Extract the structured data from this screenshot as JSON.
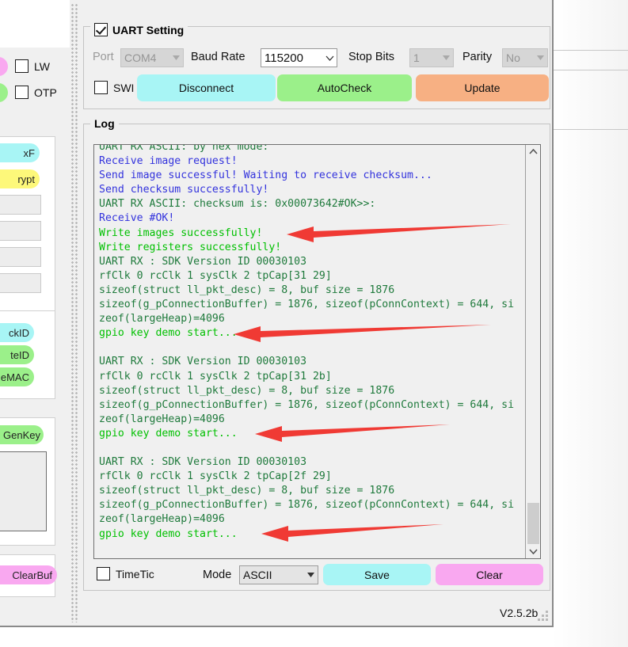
{
  "window": {
    "version_label": "V2.5.2b"
  },
  "sidebar": {
    "checkboxes": [
      {
        "label": "LW",
        "checked": false
      },
      {
        "label": "OTP",
        "checked": false
      }
    ],
    "pills": [
      {
        "label": "xF",
        "color": "#a8f5f5"
      },
      {
        "label": "rypt",
        "color": "#fdf87a"
      },
      {
        "label": "ckID",
        "color": "#a8f5f5"
      },
      {
        "label": "teID",
        "color": "#9bf08a"
      },
      {
        "label": "eMAC",
        "color": "#9bf08a"
      },
      {
        "label": "GenKey",
        "color": "#9bf08a"
      },
      {
        "label": "ClearBuf",
        "color": "#f9a8f0"
      }
    ],
    "edge_pills": [
      {
        "color": "#f9a8f0"
      },
      {
        "color": "#9bf08a"
      }
    ]
  },
  "uart_setting": {
    "title": "UART Setting",
    "enabled": true,
    "port": {
      "label": "Port",
      "value": "COM4",
      "disabled": true
    },
    "baud_rate": {
      "label": "Baud Rate",
      "value": "115200",
      "disabled": false
    },
    "stop_bits": {
      "label": "Stop Bits",
      "value": "1",
      "disabled": true
    },
    "parity": {
      "label": "Parity",
      "value": "No",
      "disabled": true
    },
    "swi": {
      "label": "SWI",
      "checked": false
    },
    "buttons": [
      {
        "label": "Disconnect",
        "color": "#a8f5f5"
      },
      {
        "label": "AutoCheck",
        "color": "#9bf08a"
      },
      {
        "label": "Update",
        "color": "#f7b083"
      }
    ]
  },
  "log": {
    "title": "Log",
    "lines": [
      {
        "text": "UART RX ASCII: by hex mode:",
        "color": "dark"
      },
      {
        "text": "Receive image request!",
        "color": "blue"
      },
      {
        "text": "Send image successful! Waiting to receive checksum...",
        "color": "blue"
      },
      {
        "text": "Send checksum successfully!",
        "color": "blue"
      },
      {
        "text": "UART RX ASCII: checksum is: 0x00073642#OK>>:",
        "color": "dark"
      },
      {
        "text": "Receive #OK!",
        "color": "blue"
      },
      {
        "text": "Write images successfully!",
        "color": "bright"
      },
      {
        "text": "Write registers successfully!",
        "color": "bright"
      },
      {
        "text": "UART RX : SDK Version ID 00030103",
        "color": "dark"
      },
      {
        "text": "rfClk 0 rcClk 1 sysClk 2 tpCap[31 29]",
        "color": "dark"
      },
      {
        "text": "sizeof(struct ll_pkt_desc) = 8, buf size = 1876",
        "color": "dark"
      },
      {
        "text": "sizeof(g_pConnectionBuffer) = 1876, sizeof(pConnContext) = 644, si",
        "color": "dark"
      },
      {
        "text": "zeof(largeHeap)=4096",
        "color": "dark"
      },
      {
        "text": "gpio key demo start...",
        "color": "bright"
      },
      {
        "text": "",
        "color": "dark"
      },
      {
        "text": "UART RX : SDK Version ID 00030103",
        "color": "dark"
      },
      {
        "text": "rfClk 0 rcClk 1 sysClk 2 tpCap[31 2b]",
        "color": "dark"
      },
      {
        "text": "sizeof(struct ll_pkt_desc) = 8, buf size = 1876",
        "color": "dark"
      },
      {
        "text": "sizeof(g_pConnectionBuffer) = 1876, sizeof(pConnContext) = 644, si",
        "color": "dark"
      },
      {
        "text": "zeof(largeHeap)=4096",
        "color": "dark"
      },
      {
        "text": "gpio key demo start...",
        "color": "bright"
      },
      {
        "text": "",
        "color": "dark"
      },
      {
        "text": "UART RX : SDK Version ID 00030103",
        "color": "dark"
      },
      {
        "text": "rfClk 0 rcClk 1 sysClk 2 tpCap[2f 29]",
        "color": "dark"
      },
      {
        "text": "sizeof(struct ll_pkt_desc) = 8, buf size = 1876",
        "color": "dark"
      },
      {
        "text": "sizeof(g_pConnectionBuffer) = 1876, sizeof(pConnContext) = 644, si",
        "color": "dark"
      },
      {
        "text": "zeof(largeHeap)=4096",
        "color": "dark"
      },
      {
        "text": "gpio key demo start...",
        "color": "bright"
      }
    ],
    "scrollbar": {
      "up_icon": "chevron-up-icon",
      "down_icon": "chevron-down-icon"
    }
  },
  "log_toolbar": {
    "timetic": {
      "label": "TimeTic",
      "checked": false
    },
    "mode": {
      "label": "Mode",
      "value": "ASCII"
    },
    "buttons": [
      {
        "label": "Save",
        "color": "#a8f5f5"
      },
      {
        "label": "Clear",
        "color": "#f9a8f0"
      }
    ]
  },
  "annotations": {
    "arrow_color": "#f03a34",
    "arrows": [
      {
        "target": "write-images-successfully"
      },
      {
        "target": "gpio-key-demo-start-1"
      },
      {
        "target": "gpio-key-demo-start-2"
      },
      {
        "target": "gpio-key-demo-start-3"
      }
    ]
  },
  "colors": {
    "log_dark_green": "#1f7a3c",
    "log_blue": "#3333dd",
    "log_bright_green": "#00c000",
    "window_bg": "#f0f0f0"
  }
}
